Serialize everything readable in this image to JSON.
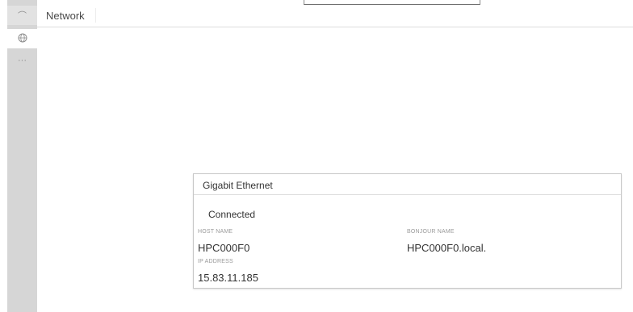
{
  "header": {
    "title": "Network"
  },
  "sidebar": {
    "items": [
      {
        "icon": "home-icon",
        "glyph": "⌒"
      },
      {
        "icon": "network-globe-icon",
        "glyph": "◎"
      },
      {
        "icon": "more-icon",
        "glyph": "···"
      }
    ]
  },
  "card": {
    "title": "Gigabit Ethernet",
    "status": "Connected",
    "host_name_label": "HOST NAME",
    "host_name_value": "HPC000F0",
    "bonjour_name_label": "BONJOUR NAME",
    "bonjour_name_value": "HPC000F0.local.",
    "ip_address_label": "IP ADDRESS",
    "ip_address_value": "15.83.11.185"
  },
  "colors": {
    "sidebar_bg": "#d6d6d6",
    "selected_item_bg": "#ffffff",
    "card_border": "#c8c8c8"
  }
}
